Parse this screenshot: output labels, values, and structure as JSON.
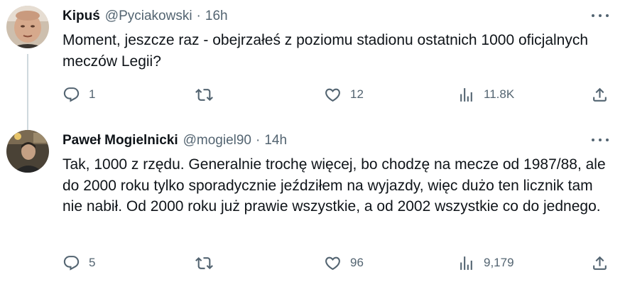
{
  "tweets": [
    {
      "name": "Kipuś",
      "handle": "@Pyciakowski",
      "separator": "·",
      "time": "16h",
      "text": "Moment, jeszcze raz - obejrzałeś z poziomu stadionu ostatnich 1000 oficjalnych meczów Legii?",
      "replies": "1",
      "retweets": "",
      "likes": "12",
      "views": "11.8K"
    },
    {
      "name": "Paweł Mogielnicki",
      "handle": "@mogiel90",
      "separator": "·",
      "time": "14h",
      "text": "Tak, 1000 z rzędu. Generalnie trochę więcej, bo chodzę na mecze od 1987/88, ale do 2000 roku tylko sporadycznie jeździłem na wyjazdy, więc dużo ten licznik tam nie nabił. Od 2000 roku już prawie wszystkie, a od 2002 wszystkie co do jednego.",
      "replies": "5",
      "retweets": "",
      "likes": "96",
      "views": "9,179"
    }
  ],
  "icons": {
    "reply": "reply-icon",
    "retweet": "retweet-icon",
    "like": "heart-icon",
    "views": "views-chart-icon",
    "share": "share-icon",
    "more": "more-dots-icon"
  },
  "colors": {
    "text": "#0f1419",
    "secondary": "#536471",
    "thread_line": "#cfd9de"
  }
}
